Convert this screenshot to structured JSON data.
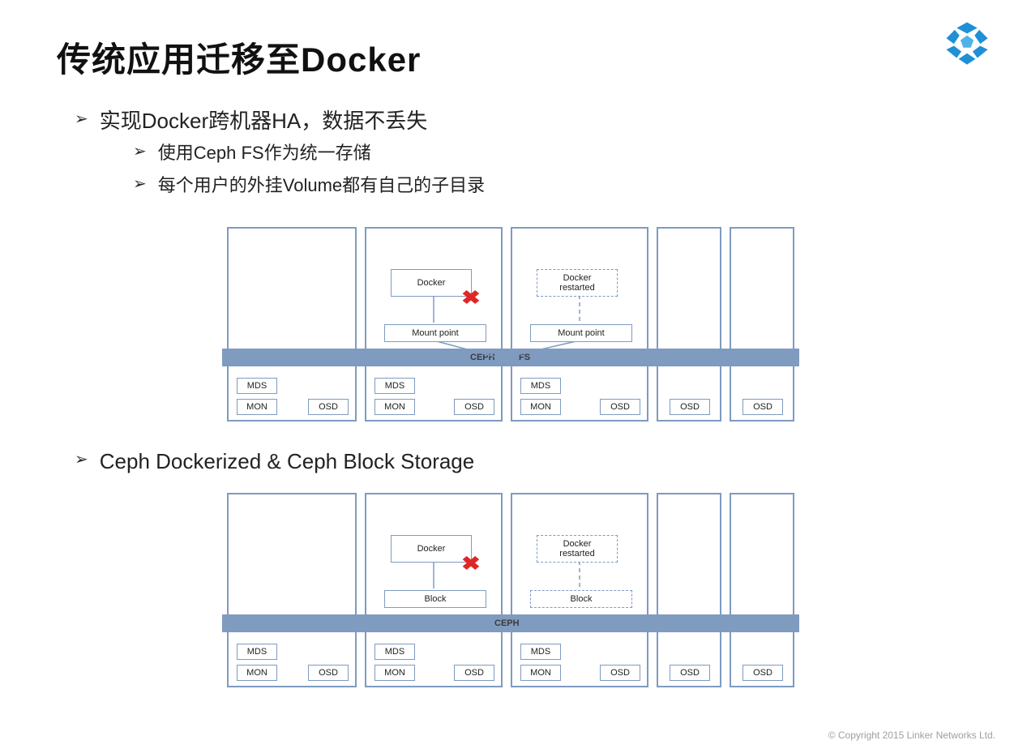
{
  "title": "传统应用迁移至Docker",
  "bullets": {
    "main1": "实现Docker跨机器HA，数据不丢失",
    "sub1": "使用Ceph FS作为统一存储",
    "sub2": "每个用户的外挂Volume都有自己的子目录",
    "main2": "Ceph Dockerized & Ceph Block Storage"
  },
  "labels": {
    "docker": "Docker",
    "docker_restarted_l1": "Docker",
    "docker_restarted_l2": "restarted",
    "mount_point": "Mount point",
    "block": "Block",
    "mds": "MDS",
    "mon": "MON",
    "osd": "OSD",
    "ceph": "CEPH",
    "fs": "FS"
  },
  "copyright": "© Copyright 2015 Linker Networks Ltd."
}
